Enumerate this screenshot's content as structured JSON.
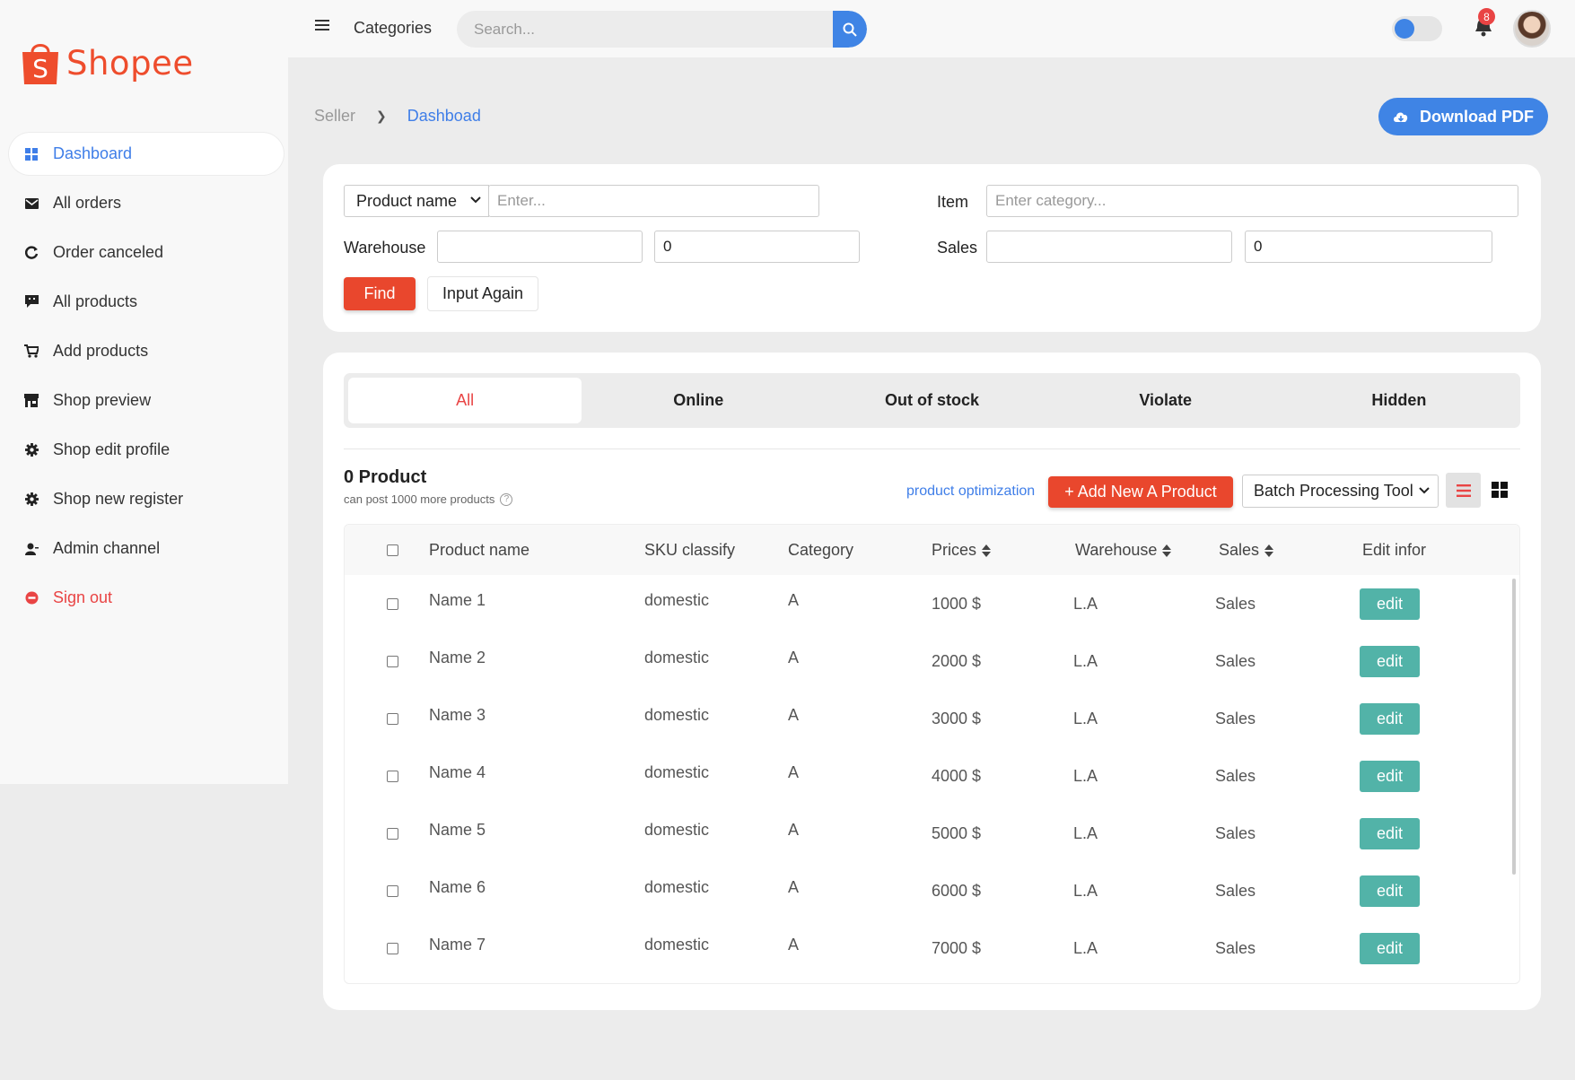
{
  "brand": {
    "name": "Shopee",
    "color": "#ee4d2d"
  },
  "sidebar": {
    "items": [
      {
        "label": "Dashboard",
        "icon": "dashboard-grid-icon",
        "active": true
      },
      {
        "label": "All orders",
        "icon": "envelope-icon"
      },
      {
        "label": "Order canceled",
        "icon": "refresh-icon"
      },
      {
        "label": "All products",
        "icon": "comment-icon"
      },
      {
        "label": "Add products",
        "icon": "cart-plus-icon"
      },
      {
        "label": "Shop preview",
        "icon": "store-icon"
      },
      {
        "label": "Shop edit profile",
        "icon": "gear-icon"
      },
      {
        "label": "Shop new register",
        "icon": "gear-icon"
      },
      {
        "label": "Admin channel",
        "icon": "user-icon"
      },
      {
        "label": "Sign out",
        "icon": "sign-out-icon"
      }
    ]
  },
  "topbar": {
    "categories_label": "Categories",
    "search_placeholder": "Search...",
    "notification_count": "8",
    "accent": "#3f84e5"
  },
  "breadcrumb": {
    "parent": "Seller",
    "current": "Dashboad"
  },
  "download_label": "Download PDF",
  "filter": {
    "product_select": "Product name",
    "product_placeholder": "Enter...",
    "item_label": "Item",
    "item_placeholder": "Enter category...",
    "warehouse_label": "Warehouse",
    "warehouse_from": "",
    "warehouse_to": "0",
    "sales_label": "Sales",
    "sales_from": "",
    "sales_to": "0",
    "find_label": "Find",
    "again_label": "Input Again"
  },
  "tabs": [
    "All",
    "Online",
    "Out of stock",
    "Violate",
    "Hidden"
  ],
  "products": {
    "count_label": "0 Product",
    "sub_label": "can post 1000 more products",
    "help_glyph": "?",
    "optimization_link": "product optimization",
    "add_label": "+ Add New A Product",
    "batch_label": "Batch Processing Tool"
  },
  "table": {
    "headers": {
      "name": "Product name",
      "sku": "SKU classify",
      "category": "Category",
      "prices": "Prices",
      "warehouse": "Warehouse",
      "sales": "Sales",
      "edit": "Edit infor"
    },
    "rows": [
      {
        "name": "Name 1",
        "sku": "domestic",
        "category": "A",
        "price": "1000 $",
        "warehouse": "L.A",
        "sales": "Sales",
        "action": "edit"
      },
      {
        "name": "Name 2",
        "sku": "domestic",
        "category": "A",
        "price": "2000 $",
        "warehouse": "L.A",
        "sales": "Sales",
        "action": "edit"
      },
      {
        "name": "Name 3",
        "sku": "domestic",
        "category": "A",
        "price": "3000 $",
        "warehouse": "L.A",
        "sales": "Sales",
        "action": "edit"
      },
      {
        "name": "Name 4",
        "sku": "domestic",
        "category": "A",
        "price": "4000 $",
        "warehouse": "L.A",
        "sales": "Sales",
        "action": "edit"
      },
      {
        "name": "Name 5",
        "sku": "domestic",
        "category": "A",
        "price": "5000 $",
        "warehouse": "L.A",
        "sales": "Sales",
        "action": "edit"
      },
      {
        "name": "Name 6",
        "sku": "domestic",
        "category": "A",
        "price": "6000 $",
        "warehouse": "L.A",
        "sales": "Sales",
        "action": "edit"
      },
      {
        "name": "Name 7",
        "sku": "domestic",
        "category": "A",
        "price": "7000 $",
        "warehouse": "L.A",
        "sales": "Sales",
        "action": "edit"
      }
    ]
  },
  "colors": {
    "primary_red": "#e9472d",
    "edit_teal": "#52b3a8",
    "link_blue": "#3f7ee8"
  }
}
